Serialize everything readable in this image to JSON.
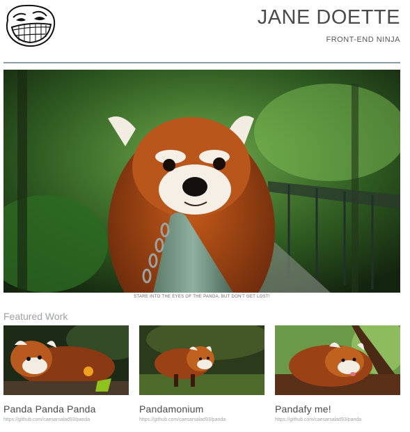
{
  "header": {
    "name": "JANE DOETTE",
    "tagline": "FRONT-END NINJA"
  },
  "hero": {
    "caption": "STARE INTO THE EYES OF THE PANDA, BUT DON'T GET LOST!"
  },
  "featured": {
    "title": "Featured Work",
    "items": [
      {
        "title": "Panda Panda Panda",
        "link": "https://github.com/caesarsalad93/panda"
      },
      {
        "title": "Pandamonium",
        "link": "https://github.com/caesarsalad93/panda"
      },
      {
        "title": "Pandafy me!",
        "link": "https://github.com/caesarsalad93/panda"
      }
    ]
  }
}
